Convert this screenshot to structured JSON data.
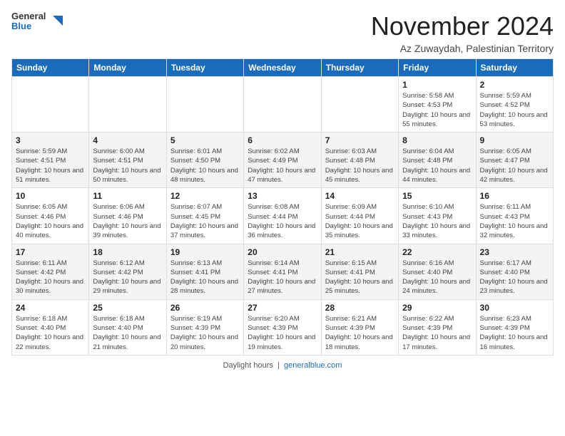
{
  "header": {
    "logo_line1": "General",
    "logo_line2": "Blue",
    "month": "November 2024",
    "location": "Az Zuwaydah, Palestinian Territory"
  },
  "weekdays": [
    "Sunday",
    "Monday",
    "Tuesday",
    "Wednesday",
    "Thursday",
    "Friday",
    "Saturday"
  ],
  "rows": [
    [
      {
        "day": "",
        "info": ""
      },
      {
        "day": "",
        "info": ""
      },
      {
        "day": "",
        "info": ""
      },
      {
        "day": "",
        "info": ""
      },
      {
        "day": "",
        "info": ""
      },
      {
        "day": "1",
        "info": "Sunrise: 5:58 AM\nSunset: 4:53 PM\nDaylight: 10 hours and 55 minutes."
      },
      {
        "day": "2",
        "info": "Sunrise: 5:59 AM\nSunset: 4:52 PM\nDaylight: 10 hours and 53 minutes."
      }
    ],
    [
      {
        "day": "3",
        "info": "Sunrise: 5:59 AM\nSunset: 4:51 PM\nDaylight: 10 hours and 51 minutes."
      },
      {
        "day": "4",
        "info": "Sunrise: 6:00 AM\nSunset: 4:51 PM\nDaylight: 10 hours and 50 minutes."
      },
      {
        "day": "5",
        "info": "Sunrise: 6:01 AM\nSunset: 4:50 PM\nDaylight: 10 hours and 48 minutes."
      },
      {
        "day": "6",
        "info": "Sunrise: 6:02 AM\nSunset: 4:49 PM\nDaylight: 10 hours and 47 minutes."
      },
      {
        "day": "7",
        "info": "Sunrise: 6:03 AM\nSunset: 4:48 PM\nDaylight: 10 hours and 45 minutes."
      },
      {
        "day": "8",
        "info": "Sunrise: 6:04 AM\nSunset: 4:48 PM\nDaylight: 10 hours and 44 minutes."
      },
      {
        "day": "9",
        "info": "Sunrise: 6:05 AM\nSunset: 4:47 PM\nDaylight: 10 hours and 42 minutes."
      }
    ],
    [
      {
        "day": "10",
        "info": "Sunrise: 6:05 AM\nSunset: 4:46 PM\nDaylight: 10 hours and 40 minutes."
      },
      {
        "day": "11",
        "info": "Sunrise: 6:06 AM\nSunset: 4:46 PM\nDaylight: 10 hours and 39 minutes."
      },
      {
        "day": "12",
        "info": "Sunrise: 6:07 AM\nSunset: 4:45 PM\nDaylight: 10 hours and 37 minutes."
      },
      {
        "day": "13",
        "info": "Sunrise: 6:08 AM\nSunset: 4:44 PM\nDaylight: 10 hours and 36 minutes."
      },
      {
        "day": "14",
        "info": "Sunrise: 6:09 AM\nSunset: 4:44 PM\nDaylight: 10 hours and 35 minutes."
      },
      {
        "day": "15",
        "info": "Sunrise: 6:10 AM\nSunset: 4:43 PM\nDaylight: 10 hours and 33 minutes."
      },
      {
        "day": "16",
        "info": "Sunrise: 6:11 AM\nSunset: 4:43 PM\nDaylight: 10 hours and 32 minutes."
      }
    ],
    [
      {
        "day": "17",
        "info": "Sunrise: 6:11 AM\nSunset: 4:42 PM\nDaylight: 10 hours and 30 minutes."
      },
      {
        "day": "18",
        "info": "Sunrise: 6:12 AM\nSunset: 4:42 PM\nDaylight: 10 hours and 29 minutes."
      },
      {
        "day": "19",
        "info": "Sunrise: 6:13 AM\nSunset: 4:41 PM\nDaylight: 10 hours and 28 minutes."
      },
      {
        "day": "20",
        "info": "Sunrise: 6:14 AM\nSunset: 4:41 PM\nDaylight: 10 hours and 27 minutes."
      },
      {
        "day": "21",
        "info": "Sunrise: 6:15 AM\nSunset: 4:41 PM\nDaylight: 10 hours and 25 minutes."
      },
      {
        "day": "22",
        "info": "Sunrise: 6:16 AM\nSunset: 4:40 PM\nDaylight: 10 hours and 24 minutes."
      },
      {
        "day": "23",
        "info": "Sunrise: 6:17 AM\nSunset: 4:40 PM\nDaylight: 10 hours and 23 minutes."
      }
    ],
    [
      {
        "day": "24",
        "info": "Sunrise: 6:18 AM\nSunset: 4:40 PM\nDaylight: 10 hours and 22 minutes."
      },
      {
        "day": "25",
        "info": "Sunrise: 6:18 AM\nSunset: 4:40 PM\nDaylight: 10 hours and 21 minutes."
      },
      {
        "day": "26",
        "info": "Sunrise: 6:19 AM\nSunset: 4:39 PM\nDaylight: 10 hours and 20 minutes."
      },
      {
        "day": "27",
        "info": "Sunrise: 6:20 AM\nSunset: 4:39 PM\nDaylight: 10 hours and 19 minutes."
      },
      {
        "day": "28",
        "info": "Sunrise: 6:21 AM\nSunset: 4:39 PM\nDaylight: 10 hours and 18 minutes."
      },
      {
        "day": "29",
        "info": "Sunrise: 6:22 AM\nSunset: 4:39 PM\nDaylight: 10 hours and 17 minutes."
      },
      {
        "day": "30",
        "info": "Sunrise: 6:23 AM\nSunset: 4:39 PM\nDaylight: 10 hours and 16 minutes."
      }
    ]
  ],
  "footer": {
    "text": "Daylight hours",
    "link": "https://www.generalblue.com"
  }
}
